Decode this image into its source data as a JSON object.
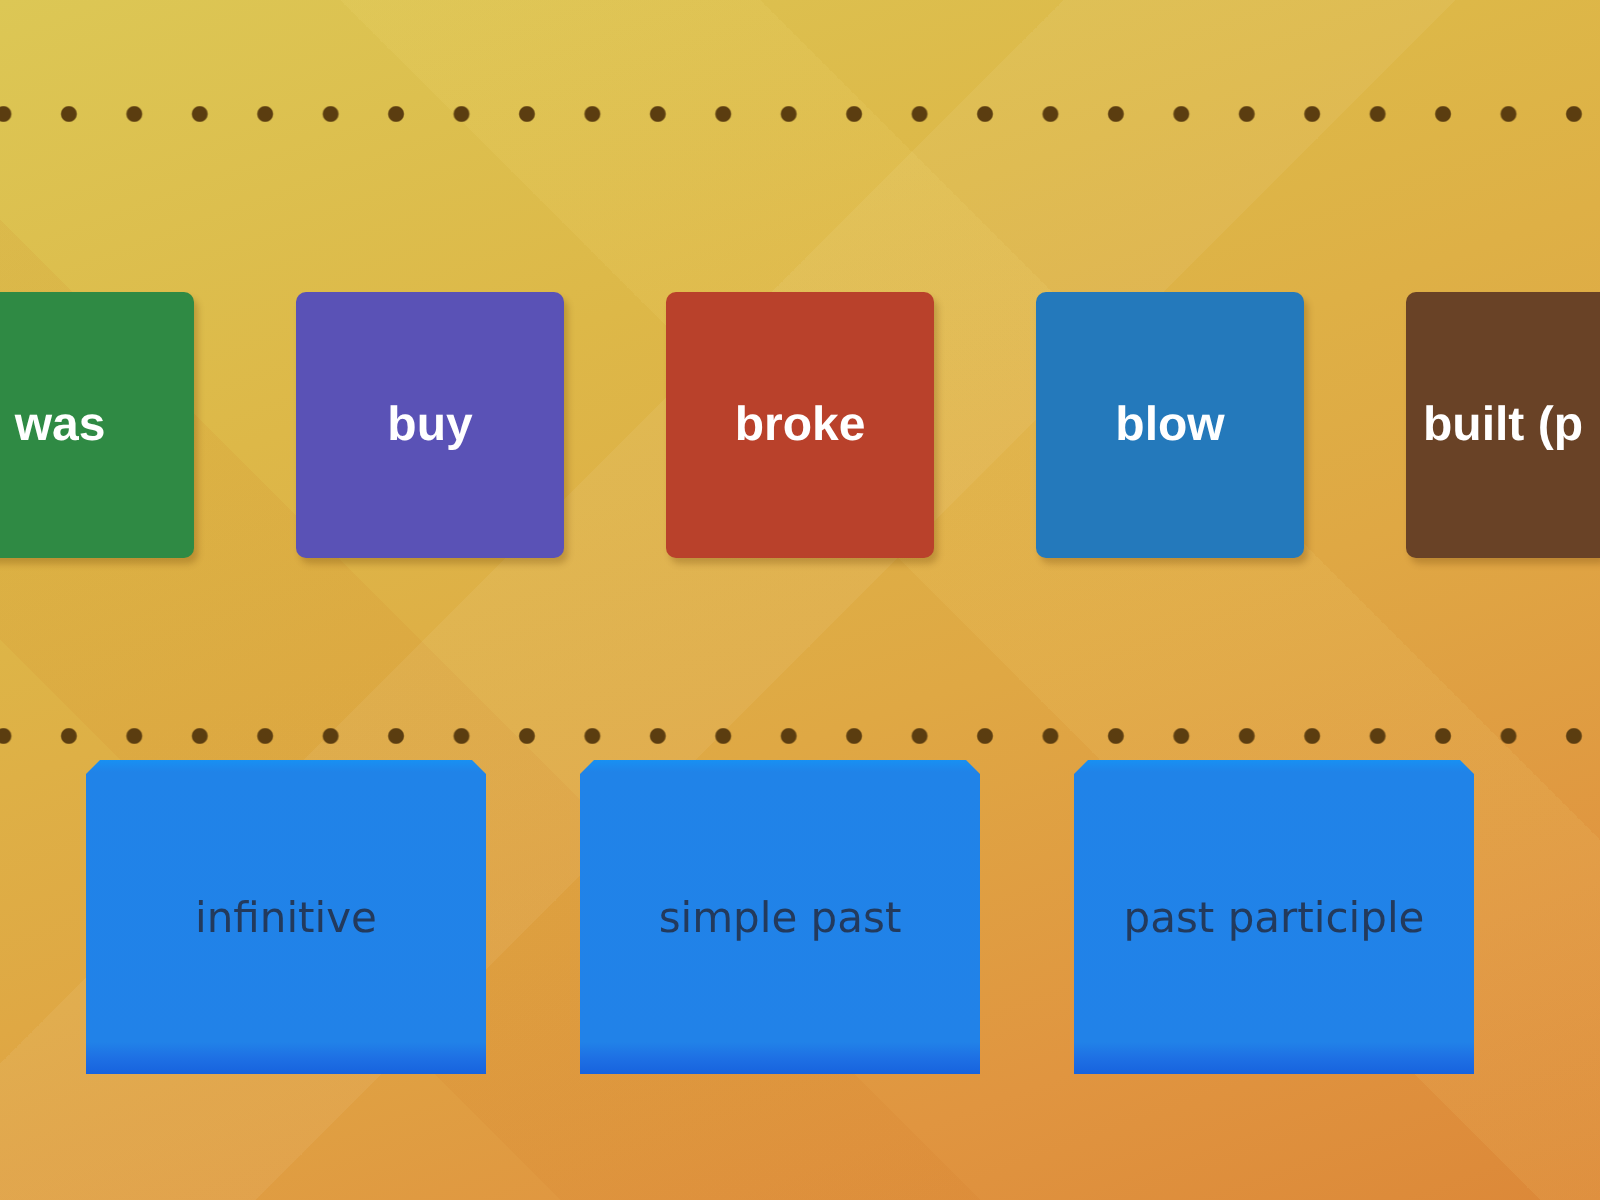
{
  "tiles": [
    {
      "text": "was",
      "color": "#2f8a44"
    },
    {
      "text": "buy",
      "color": "#5a52b6"
    },
    {
      "text": "broke",
      "color": "#b9412b"
    },
    {
      "text": "blow",
      "color": "#2479bb"
    },
    {
      "text": "built (p",
      "color": "#694226"
    }
  ],
  "categories": [
    {
      "label": "infinitive"
    },
    {
      "label": "simple past"
    },
    {
      "label": "past participle"
    }
  ]
}
